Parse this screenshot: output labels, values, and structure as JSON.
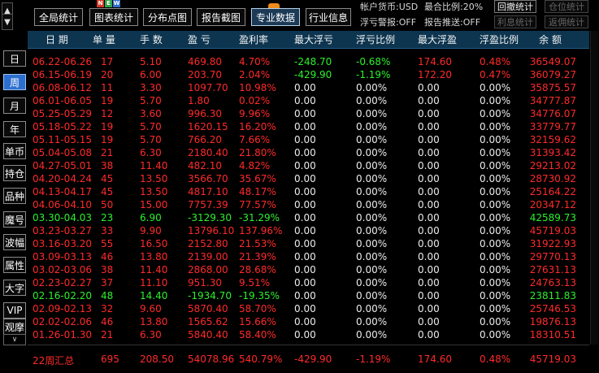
{
  "nav_arrows": {
    "up": "▲",
    "down": "▼"
  },
  "toolbar": {
    "buttons": [
      {
        "label": "全局统计",
        "active": false
      },
      {
        "label": "图表统计",
        "active": false
      },
      {
        "label": "分布点图",
        "active": false
      },
      {
        "label": "报告截图",
        "active": false
      },
      {
        "label": "专业数据",
        "active": true
      },
      {
        "label": "行业信息",
        "active": false
      }
    ],
    "new_badge": [
      "N",
      "E",
      "W"
    ],
    "account_currency": "帐户货币:USD",
    "max_position_ratio": "最合比例:20%",
    "float_loss_alert": "浮亏警报:OFF",
    "report_push": "报告推送:OFF",
    "small_buttons": [
      {
        "label": "回撤统计",
        "disabled": false
      },
      {
        "label": "仓位统计",
        "disabled": true
      },
      {
        "label": "利息统计",
        "disabled": true
      },
      {
        "label": "返佣统计",
        "disabled": true
      }
    ]
  },
  "sidebar": {
    "items": [
      {
        "label": "日",
        "active": false
      },
      {
        "label": "周",
        "active": true
      },
      {
        "label": "月",
        "active": false
      },
      {
        "label": "年",
        "active": false
      },
      {
        "label": "单币",
        "active": false
      },
      {
        "label": "持仓",
        "active": false
      },
      {
        "label": "品种",
        "active": false
      },
      {
        "label": "魔号",
        "active": false
      },
      {
        "label": "波幅",
        "active": false
      },
      {
        "label": "属性",
        "active": false
      },
      {
        "label": "大字",
        "active": false
      },
      {
        "label": "VIP",
        "active": false
      },
      {
        "label": "观摩",
        "active": false
      }
    ],
    "scroll_down": "∨"
  },
  "table": {
    "headers": [
      "日 期",
      "单 量",
      "手 数",
      "盈 亏",
      "盈利率",
      "最大浮亏",
      "浮亏比例",
      "最大浮盈",
      "浮盈比例",
      "余 额"
    ],
    "rows": [
      {
        "date": "06.22-06.26",
        "count": "17",
        "lots": "5.10",
        "pl": "469.80",
        "rate": "4.70%",
        "max_float_loss": "-248.70",
        "float_loss_ratio": "-0.68%",
        "max_float_profit": "174.60",
        "float_profit_ratio": "0.48%",
        "balance": "36549.07",
        "trend": "up"
      },
      {
        "date": "06.15-06.19",
        "count": "20",
        "lots": "6.00",
        "pl": "203.70",
        "rate": "2.04%",
        "max_float_loss": "-429.90",
        "float_loss_ratio": "-1.19%",
        "max_float_profit": "172.20",
        "float_profit_ratio": "0.47%",
        "balance": "36079.27",
        "trend": "up"
      },
      {
        "date": "06.08-06.12",
        "count": "11",
        "lots": "3.30",
        "pl": "1097.70",
        "rate": "10.98%",
        "max_float_loss": "0.00",
        "float_loss_ratio": "0.00%",
        "max_float_profit": "0.00",
        "float_profit_ratio": "0.00%",
        "balance": "35875.57",
        "trend": "up"
      },
      {
        "date": "06.01-06.05",
        "count": "19",
        "lots": "5.70",
        "pl": "1.80",
        "rate": "0.02%",
        "max_float_loss": "0.00",
        "float_loss_ratio": "0.00%",
        "max_float_profit": "0.00",
        "float_profit_ratio": "0.00%",
        "balance": "34777.87",
        "trend": "up"
      },
      {
        "date": "05.25-05.29",
        "count": "12",
        "lots": "3.60",
        "pl": "996.30",
        "rate": "9.96%",
        "max_float_loss": "0.00",
        "float_loss_ratio": "0.00%",
        "max_float_profit": "0.00",
        "float_profit_ratio": "0.00%",
        "balance": "34776.07",
        "trend": "up"
      },
      {
        "date": "05.18-05.22",
        "count": "19",
        "lots": "5.70",
        "pl": "1620.15",
        "rate": "16.20%",
        "max_float_loss": "0.00",
        "float_loss_ratio": "0.00%",
        "max_float_profit": "0.00",
        "float_profit_ratio": "0.00%",
        "balance": "33779.77",
        "trend": "up"
      },
      {
        "date": "05.11-05.15",
        "count": "19",
        "lots": "5.70",
        "pl": "766.20",
        "rate": "7.66%",
        "max_float_loss": "0.00",
        "float_loss_ratio": "0.00%",
        "max_float_profit": "0.00",
        "float_profit_ratio": "0.00%",
        "balance": "32159.62",
        "trend": "up"
      },
      {
        "date": "05.04-05.08",
        "count": "21",
        "lots": "6.30",
        "pl": "2180.40",
        "rate": "21.80%",
        "max_float_loss": "0.00",
        "float_loss_ratio": "0.00%",
        "max_float_profit": "0.00",
        "float_profit_ratio": "0.00%",
        "balance": "31393.42",
        "trend": "up"
      },
      {
        "date": "04.27-05.01",
        "count": "38",
        "lots": "11.40",
        "pl": "482.10",
        "rate": "4.82%",
        "max_float_loss": "0.00",
        "float_loss_ratio": "0.00%",
        "max_float_profit": "0.00",
        "float_profit_ratio": "0.00%",
        "balance": "29213.02",
        "trend": "up"
      },
      {
        "date": "04.20-04.24",
        "count": "45",
        "lots": "13.50",
        "pl": "3566.70",
        "rate": "35.67%",
        "max_float_loss": "0.00",
        "float_loss_ratio": "0.00%",
        "max_float_profit": "0.00",
        "float_profit_ratio": "0.00%",
        "balance": "28730.92",
        "trend": "up"
      },
      {
        "date": "04.13-04.17",
        "count": "45",
        "lots": "13.50",
        "pl": "4817.10",
        "rate": "48.17%",
        "max_float_loss": "0.00",
        "float_loss_ratio": "0.00%",
        "max_float_profit": "0.00",
        "float_profit_ratio": "0.00%",
        "balance": "25164.22",
        "trend": "up"
      },
      {
        "date": "04.06-04.10",
        "count": "50",
        "lots": "15.00",
        "pl": "7757.39",
        "rate": "77.57%",
        "max_float_loss": "0.00",
        "float_loss_ratio": "0.00%",
        "max_float_profit": "0.00",
        "float_profit_ratio": "0.00%",
        "balance": "20347.12",
        "trend": "up"
      },
      {
        "date": "03.30-04.03",
        "count": "23",
        "lots": "6.90",
        "pl": "-3129.30",
        "rate": "-31.29%",
        "max_float_loss": "0.00",
        "float_loss_ratio": "0.00%",
        "max_float_profit": "0.00",
        "float_profit_ratio": "0.00%",
        "balance": "42589.73",
        "trend": "down"
      },
      {
        "date": "03.23-03.27",
        "count": "33",
        "lots": "9.90",
        "pl": "13796.10",
        "rate": "137.96%",
        "max_float_loss": "0.00",
        "float_loss_ratio": "0.00%",
        "max_float_profit": "0.00",
        "float_profit_ratio": "0.00%",
        "balance": "45719.03",
        "trend": "up"
      },
      {
        "date": "03.16-03.20",
        "count": "55",
        "lots": "16.50",
        "pl": "2152.80",
        "rate": "21.53%",
        "max_float_loss": "0.00",
        "float_loss_ratio": "0.00%",
        "max_float_profit": "0.00",
        "float_profit_ratio": "0.00%",
        "balance": "31922.93",
        "trend": "up"
      },
      {
        "date": "03.09-03.13",
        "count": "46",
        "lots": "13.80",
        "pl": "2139.00",
        "rate": "21.39%",
        "max_float_loss": "0.00",
        "float_loss_ratio": "0.00%",
        "max_float_profit": "0.00",
        "float_profit_ratio": "0.00%",
        "balance": "29770.13",
        "trend": "up"
      },
      {
        "date": "03.02-03.06",
        "count": "38",
        "lots": "11.40",
        "pl": "2868.00",
        "rate": "28.68%",
        "max_float_loss": "0.00",
        "float_loss_ratio": "0.00%",
        "max_float_profit": "0.00",
        "float_profit_ratio": "0.00%",
        "balance": "27631.13",
        "trend": "up"
      },
      {
        "date": "02.23-02.27",
        "count": "37",
        "lots": "11.10",
        "pl": "951.30",
        "rate": "9.51%",
        "max_float_loss": "0.00",
        "float_loss_ratio": "0.00%",
        "max_float_profit": "0.00",
        "float_profit_ratio": "0.00%",
        "balance": "24763.13",
        "trend": "up"
      },
      {
        "date": "02.16-02.20",
        "count": "48",
        "lots": "14.40",
        "pl": "-1934.70",
        "rate": "-19.35%",
        "max_float_loss": "0.00",
        "float_loss_ratio": "0.00%",
        "max_float_profit": "0.00",
        "float_profit_ratio": "0.00%",
        "balance": "23811.83",
        "trend": "down"
      },
      {
        "date": "02.09-02.13",
        "count": "32",
        "lots": "9.60",
        "pl": "5870.40",
        "rate": "58.70%",
        "max_float_loss": "0.00",
        "float_loss_ratio": "0.00%",
        "max_float_profit": "0.00",
        "float_profit_ratio": "0.00%",
        "balance": "25746.53",
        "trend": "up"
      },
      {
        "date": "02.02-02.06",
        "count": "46",
        "lots": "13.80",
        "pl": "1565.62",
        "rate": "15.66%",
        "max_float_loss": "0.00",
        "float_loss_ratio": "0.00%",
        "max_float_profit": "0.00",
        "float_profit_ratio": "0.00%",
        "balance": "19876.13",
        "trend": "up"
      },
      {
        "date": "01.26-01.30",
        "count": "21",
        "lots": "6.30",
        "pl": "5840.40",
        "rate": "58.40%",
        "max_float_loss": "0.00",
        "float_loss_ratio": "0.00%",
        "max_float_profit": "0.00",
        "float_profit_ratio": "0.00%",
        "balance": "18310.51",
        "trend": "up"
      }
    ],
    "summary": {
      "date": "22周汇总",
      "count": "695",
      "lots": "208.50",
      "pl": "54078.96",
      "rate": "540.79%",
      "max_float_loss": "-429.90",
      "float_loss_ratio": "-1.19%",
      "max_float_profit": "174.60",
      "float_profit_ratio": "0.48%",
      "balance": "45719.03"
    }
  },
  "colors": {
    "profit": "#ff2a2a",
    "loss": "#2cf02c",
    "header_bg": "#0d3550",
    "active_tab": "#2d6fcf"
  }
}
